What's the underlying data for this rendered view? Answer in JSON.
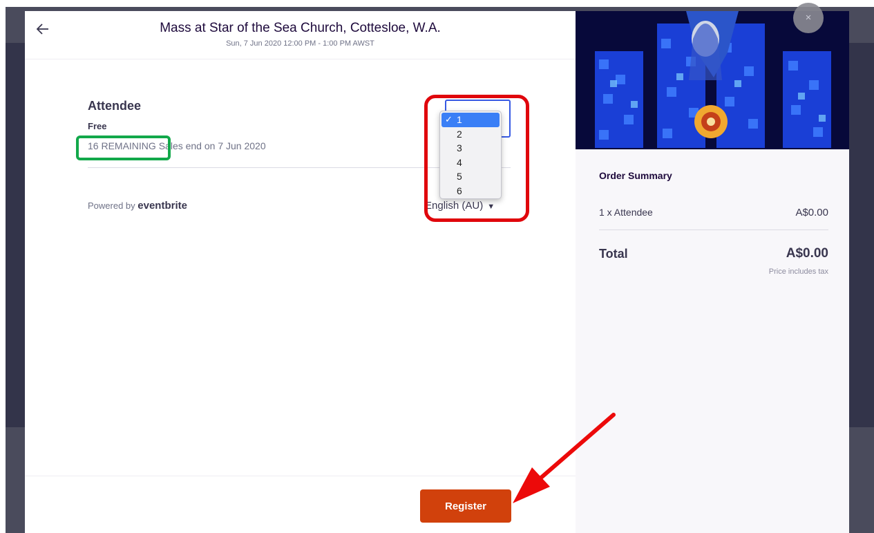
{
  "header": {
    "event_title": "Mass at Star of the Sea Church, Cottesloe, W.A.",
    "event_date": "Sun, 7 Jun 2020 12:00 PM - 1:00 PM AWST",
    "back_icon": "arrow-left-icon"
  },
  "ticket": {
    "name": "Attendee",
    "price": "Free",
    "remaining": "16 REMAINING",
    "sales_end": "Sales end on 7 Jun 2020"
  },
  "quantity": {
    "selected": "1",
    "options": [
      "1",
      "2",
      "3",
      "4",
      "5",
      "6"
    ]
  },
  "footer_info": {
    "powered_by": "Powered by",
    "brand": "eventbrite",
    "language": "English (AU)"
  },
  "actions": {
    "register_label": "Register",
    "close_label": "×"
  },
  "order_summary": {
    "title": "Order Summary",
    "line_label": "1 x Attendee",
    "line_amount": "A$0.00",
    "total_label": "Total",
    "total_amount": "A$0.00",
    "tax_note": "Price includes tax"
  },
  "colors": {
    "register": "#d1410c",
    "dropdown_selected": "#3a7ff6",
    "annotation_red": "#e0060c",
    "annotation_green": "#12a84a",
    "qty_focus": "#3659e3"
  }
}
